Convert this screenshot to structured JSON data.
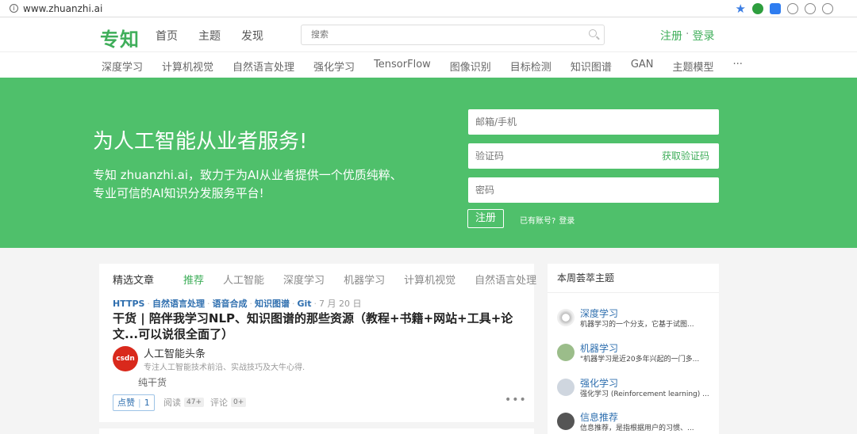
{
  "browser": {
    "url": "www.zhuanzhi.ai"
  },
  "header": {
    "logo": "专知",
    "nav": [
      "首页",
      "主题",
      "发现"
    ],
    "search_placeholder": "搜索",
    "register": "注册",
    "dot": "·",
    "login": "登录"
  },
  "topics": [
    "深度学习",
    "计算机视觉",
    "自然语言处理",
    "强化学习",
    "TensorFlow",
    "图像识别",
    "目标检测",
    "知识图谱",
    "GAN",
    "主题模型",
    "···"
  ],
  "hero": {
    "title": "为人工智能从业者服务!",
    "desc": "专知 zhuanzhi.ai，致力于为AI从业者提供一个优质纯粹、专业可信的AI知识分发服务平台!",
    "email_placeholder": "邮箱/手机",
    "code_placeholder": "验证码",
    "get_code": "获取验证码",
    "password_placeholder": "密码",
    "register_btn": "注册",
    "has_account": "已有账号?",
    "login_link": "登录"
  },
  "feed": {
    "tabs": [
      "精选文章",
      "推荐",
      "人工智能",
      "深度学习",
      "机器学习",
      "计算机视觉",
      "自然语言处理"
    ],
    "article": {
      "tags": [
        "HTTPS",
        "自然语言处理",
        "语音合成",
        "知识图谱",
        "Git"
      ],
      "date": "7 月 20 日",
      "title": "干货 | 陪伴我学习NLP、知识图谱的那些资源（教程+书籍+网站+工具+论文...可以说很全面了）",
      "avatar_text": "csdn",
      "author": "人工智能头条",
      "author_desc": "专注人工智能技术前沿、实战技巧及大牛心得.",
      "summary": "纯干货",
      "like_label": "点赞",
      "like_count": "1",
      "read_label": "阅读",
      "read_count": "47+",
      "comment_label": "评论",
      "comment_count": "0+",
      "more": "•••"
    }
  },
  "sidebar": {
    "title": "本周荟萃主题",
    "items": [
      {
        "name": "深度学习",
        "desc": "机器学习的一个分支，它基于试图..."
      },
      {
        "name": "机器学习",
        "desc": "\"机器学习是近20多年兴起的一门多..."
      },
      {
        "name": "强化学习",
        "desc": "强化学习 (Reinforcement learning) ..."
      },
      {
        "name": "信息推荐",
        "desc": "信息推荐，是指根据用户的习惯、..."
      }
    ]
  }
}
